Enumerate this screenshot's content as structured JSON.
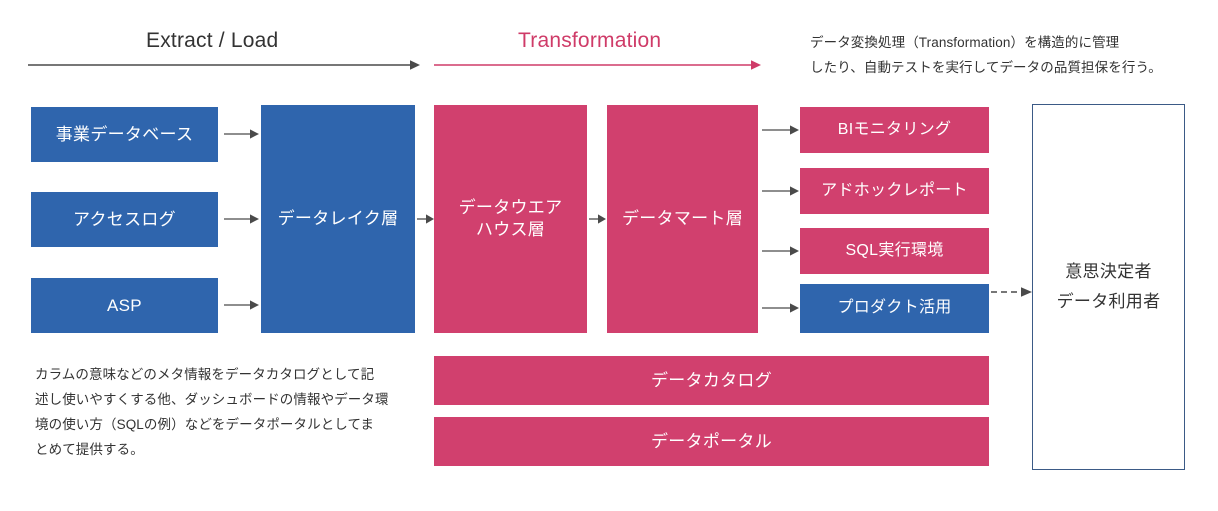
{
  "phases": [
    {
      "id": "extract_load",
      "label": "Extract / Load",
      "color": "#333333"
    },
    {
      "id": "transformation",
      "label": "Transformation",
      "color": "#cf3b68"
    }
  ],
  "notes": {
    "transformation_note": {
      "lines": [
        "データ変換処理（Transformation）を構造的に管理",
        "したり、自動テストを実行してデータの品質担保を行う。"
      ]
    },
    "catalog_note": {
      "lines": [
        "カラムの意味などのメタ情報をデータカタログとして記",
        "述し使いやすくする他、ダッシュボードの情報やデータ環",
        "境の使い方（SQLの例）などをデータポータルとしてま",
        "とめて提供する。"
      ]
    }
  },
  "sources": [
    {
      "id": "business_db",
      "label": "事業データベース",
      "color": "#2f65ad"
    },
    {
      "id": "access_log",
      "label": "アクセスログ",
      "color": "#2f65ad"
    },
    {
      "id": "asp",
      "label": "ASP",
      "color": "#2f65ad"
    }
  ],
  "layers": [
    {
      "id": "data_lake",
      "label": "データレイク層",
      "color": "#2f65ad"
    },
    {
      "id": "warehouse",
      "label": "データウエア\nハウス層",
      "line1": "データウエア",
      "line2": "ハウス層",
      "color": "#d1406e"
    },
    {
      "id": "data_mart",
      "label": "データマート層",
      "color": "#d1406e"
    }
  ],
  "consumers": [
    {
      "id": "bi_monitoring",
      "label": "BIモニタリング",
      "color": "#d1406e"
    },
    {
      "id": "adhoc_report",
      "label": "アドホックレポート",
      "color": "#d1406e"
    },
    {
      "id": "sql_env",
      "label": "SQL実行環境",
      "color": "#d1406e"
    },
    {
      "id": "product_usage",
      "label": "プロダクト活用",
      "color": "#2f65ad"
    }
  ],
  "support": [
    {
      "id": "data_catalog",
      "label": "データカタログ",
      "color": "#d1406e"
    },
    {
      "id": "data_portal",
      "label": "データポータル",
      "color": "#d1406e"
    }
  ],
  "audience": {
    "id": "decision_makers",
    "line1": "意思決定者",
    "line2": "データ利用者",
    "border_color": "#3b5a86"
  },
  "colors": {
    "blue": "#2f65ad",
    "pink": "#d1406e",
    "arrow_dark": "#4a4a4a",
    "arrow_pink": "#cf3b68",
    "outline": "#3b5a86",
    "text": "#333333"
  }
}
